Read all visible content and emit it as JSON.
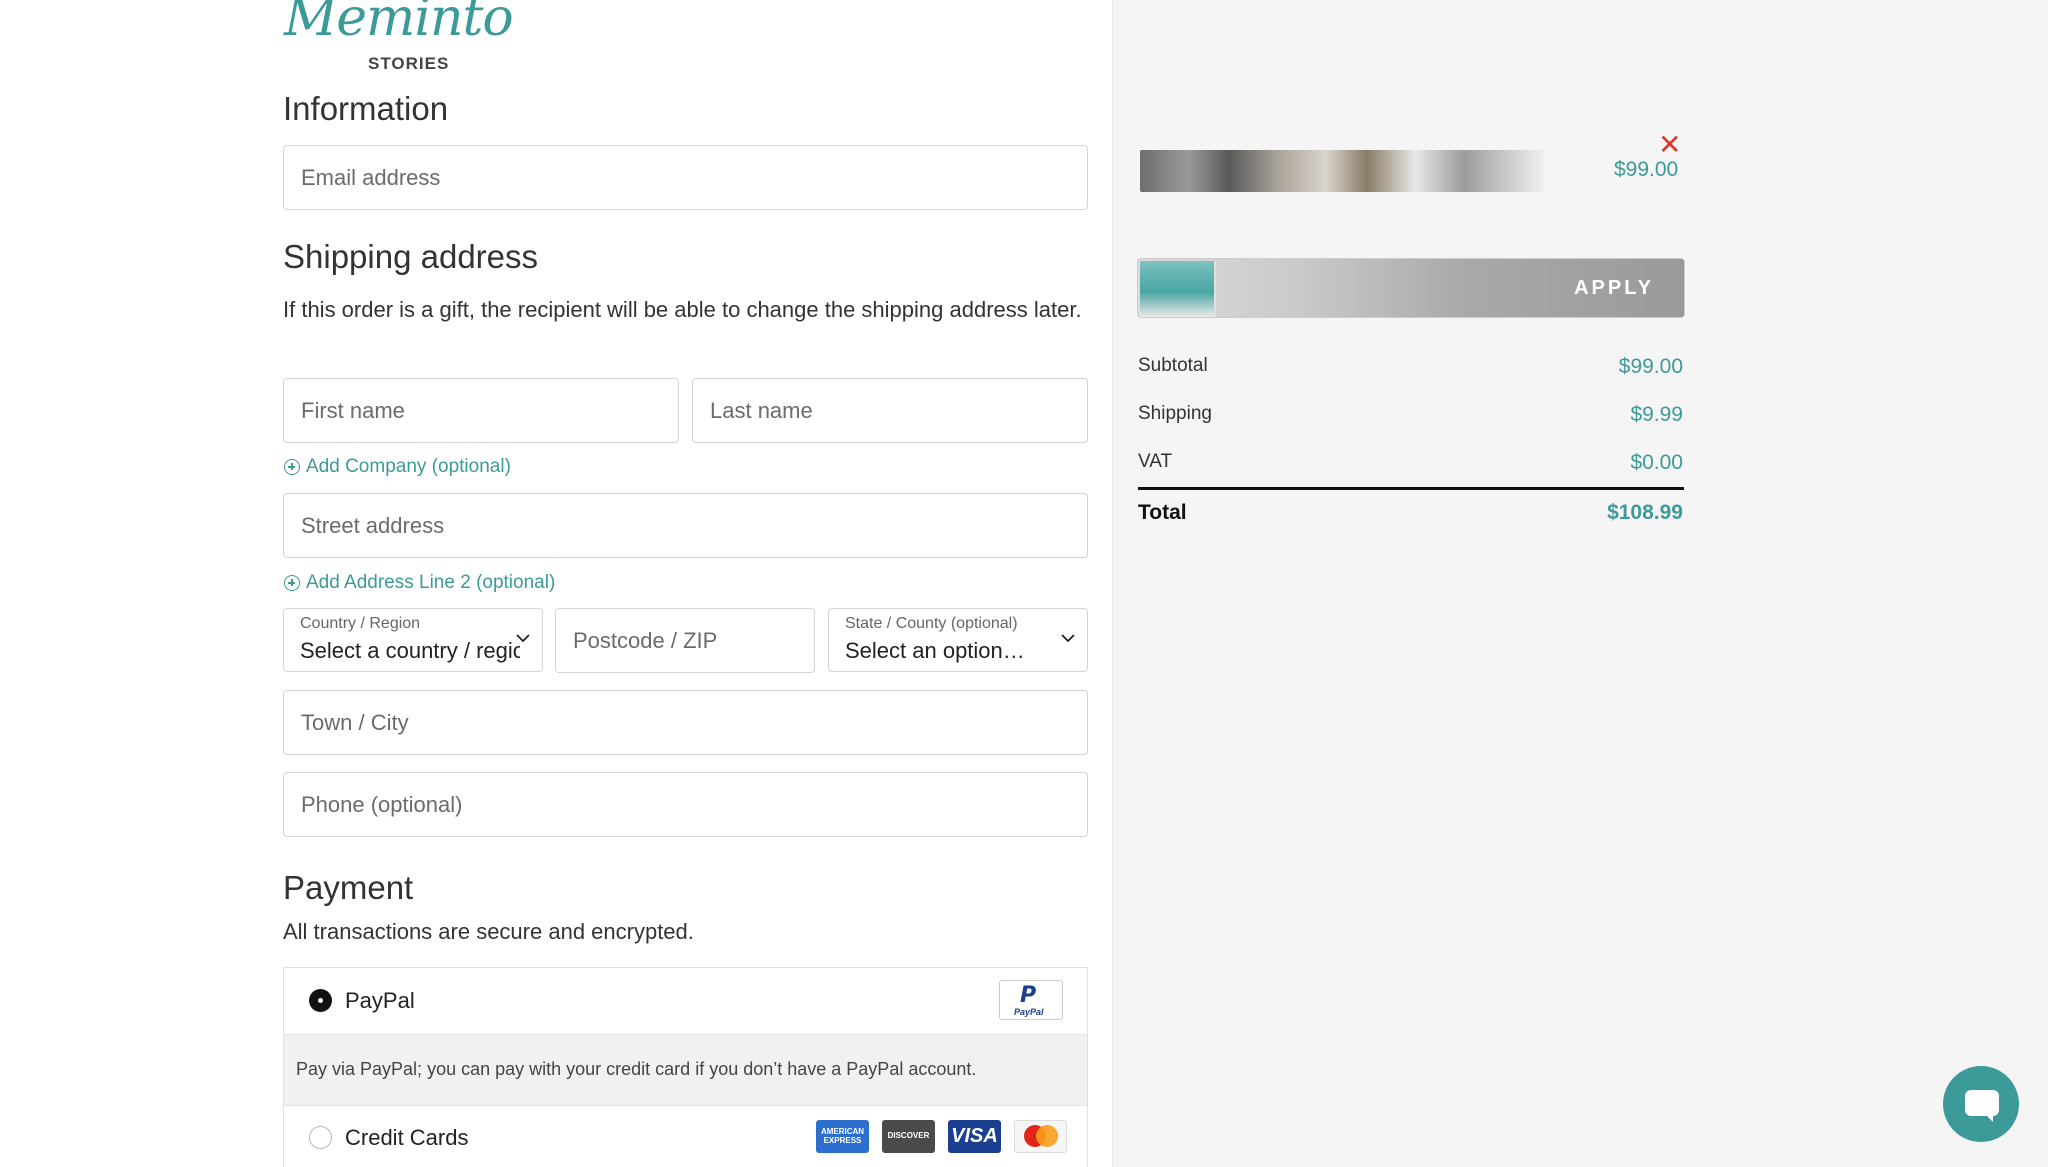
{
  "brand": {
    "script": "Meminto",
    "sub": "STORIES"
  },
  "information": {
    "heading": "Information",
    "email_placeholder": "Email address"
  },
  "shipping": {
    "heading": "Shipping address",
    "note": "If this order is a gift, the recipient will be able to change the shipping address later.",
    "first_name_placeholder": "First name",
    "last_name_placeholder": "Last name",
    "add_company": "Add Company (optional)",
    "street_placeholder": "Street address",
    "add_line2": "Add Address Line 2 (optional)",
    "country_label": "Country / Region",
    "country_value": "Select a country / region…",
    "postcode_placeholder": "Postcode / ZIP",
    "state_label": "State / County (optional)",
    "state_value": "Select an option…",
    "town_placeholder": "Town / City",
    "phone_placeholder": "Phone (optional)"
  },
  "payment": {
    "heading": "Payment",
    "note": "All transactions are secure and encrypted.",
    "paypal_label": "PayPal",
    "paypal_desc": "Pay via PayPal; you can pay with your credit card if you don’t have a PayPal account.",
    "paypal_badge_text": "PayPal",
    "credit_label": "Credit Cards",
    "card_amex": "AMERICAN EXPRESS",
    "card_discover": "DISCOVER",
    "card_visa": "VISA",
    "selected": "PayPal"
  },
  "order": {
    "item_price": "$99.00",
    "remove_symbol": "✕",
    "apply_label": "APPLY",
    "subtotal_label": "Subtotal",
    "subtotal_value": "$99.00",
    "shipping_label": "Shipping",
    "shipping_value": "$9.99",
    "vat_label": "VAT",
    "vat_value": "$0.00",
    "total_label": "Total",
    "total_value": "$108.99"
  },
  "colors": {
    "accent": "#3c9a98",
    "remove": "#d9382a",
    "panel": "#f5f5f5"
  },
  "icons": {
    "chat": "chat-bubble-icon",
    "chevron": "chevron-down-icon",
    "add": "plus-circle-icon"
  }
}
